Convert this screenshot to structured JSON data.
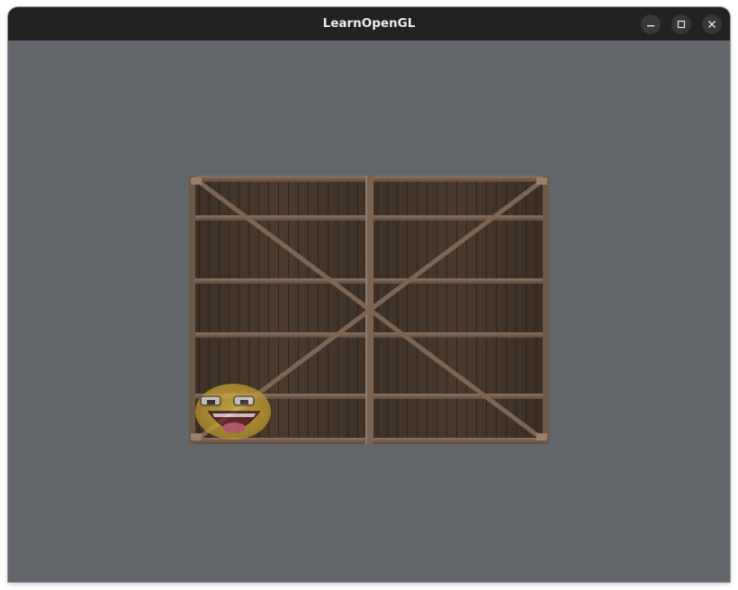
{
  "window": {
    "title": "LearnOpenGL"
  },
  "titlebar_buttons": {
    "minimize_icon": "minimize-icon",
    "maximize_icon": "maximize-icon",
    "close_icon": "close-icon"
  },
  "scene": {
    "clear_color": "#63666b",
    "textures": [
      "container",
      "awesomeface"
    ],
    "wood_color": "#4a3a2c",
    "face_color": "#d7b43a"
  }
}
